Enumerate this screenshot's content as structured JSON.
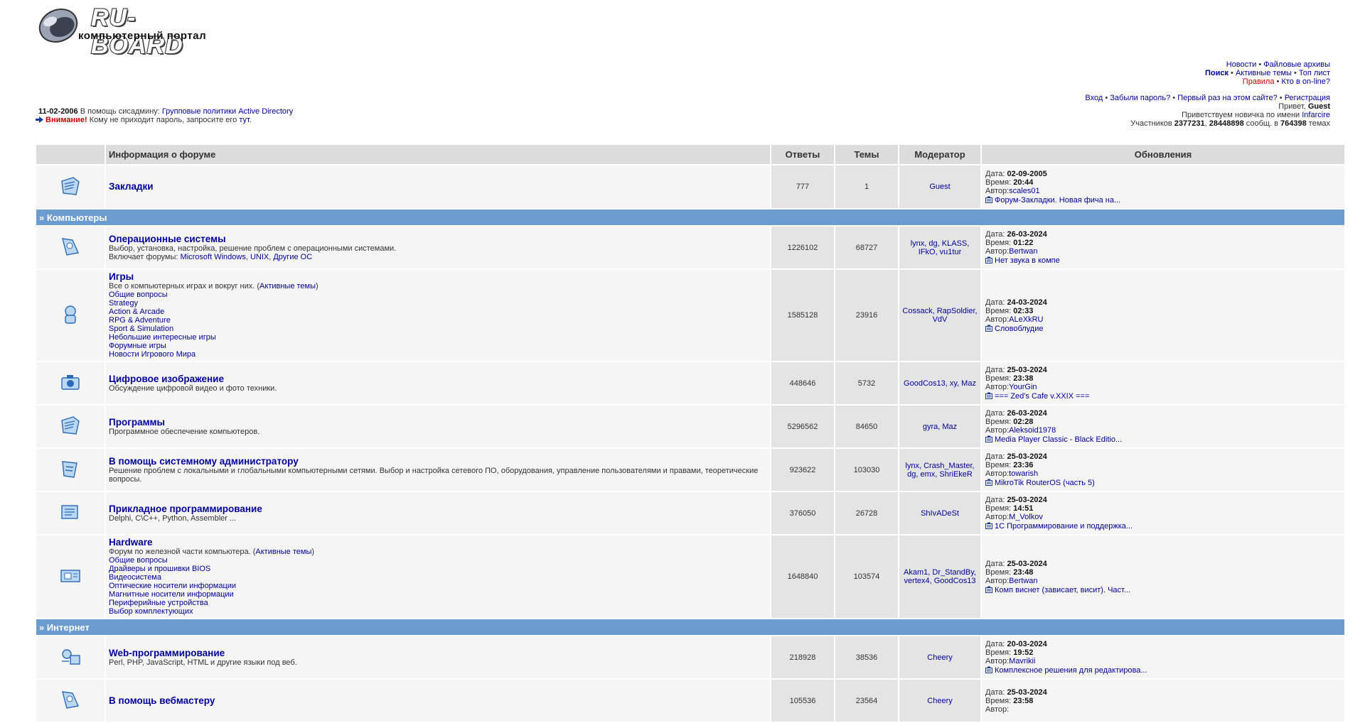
{
  "logo": {
    "title": "RU-BOARD",
    "subtitle": "компьютерный портал"
  },
  "topnav": {
    "line1": [
      "Новости",
      "Файловые архивы"
    ],
    "line2": [
      "Поиск",
      "Активные темы",
      "Топ лист"
    ],
    "line3": [
      "Правила",
      "Кто в on-line?"
    ]
  },
  "userbox": {
    "links": [
      "Вход",
      "Забыли пароль?",
      "Первый раз на этом сайте?",
      "Регистрация"
    ],
    "greeting_prefix": "Привет,",
    "greeting_user": "Guest",
    "newbie_prefix": "Приветствуем новичка по имени",
    "newbie_name": "Infarcire",
    "stats_prefix": "Участников",
    "members": "2377231",
    "posts": "28448898",
    "posts_word": "сообщ. в",
    "topics": "764398",
    "topics_word": "темах"
  },
  "news": {
    "date": "11-02-2006",
    "section": "В помощь сисадмину:",
    "link": "Групповые политики Active Directory",
    "warn": "Внимание!",
    "warn_text": "Кому не приходит пароль, запросите его",
    "warn_link": "тут"
  },
  "table_headers": {
    "info": "Информация о форуме",
    "replies": "Ответы",
    "topics": "Темы",
    "moderator": "Модератор",
    "updates": "Обновления"
  },
  "labels": {
    "date": "Дата:",
    "time": "Время:",
    "author": "Автор:"
  },
  "bookmarks": {
    "title": "Закладки",
    "replies": "777",
    "topics": "1",
    "moderator": "Guest",
    "date": "02-09-2005",
    "time": "20:44",
    "author": "scales01",
    "last": "Форум-Закладки. Новая фича на..."
  },
  "categories": [
    {
      "name": "» Компьютеры",
      "forums": [
        {
          "title": "Операционные системы",
          "desc": "Выбор, установка, настройка, решение проблем с операционными системами.",
          "includes_prefix": "Включает форумы:",
          "includes": [
            "Microsoft Windows",
            "UNIX",
            "Другие ОС"
          ],
          "replies": "1226102",
          "topics": "68727",
          "moderators": "lynx, dg, KLASS, IFkO, vu1tur",
          "date": "26-03-2024",
          "time": "01:22",
          "author": "Bertwan",
          "last": "Нет звука в компе"
        },
        {
          "title": "Игры",
          "desc": "Все о компьютерных играх и вокруг них. (",
          "desc_link": "Активные темы",
          "desc_end": ")",
          "subforums": [
            "Общие вопросы",
            "Strategy",
            "Action & Arcade",
            "RPG & Adventure",
            "Sport & Simulation",
            "Небольшие интересные игры",
            "Форумные игры",
            "Новости Игрового Мира"
          ],
          "replies": "1585128",
          "topics": "23916",
          "moderators": "Cossack, RapSoldier, VdV",
          "date": "24-03-2024",
          "time": "02:33",
          "author": "ALeXkRU",
          "last": "Словоблудие"
        },
        {
          "title": "Цифровое изображение",
          "desc": "Обсуждение цифровой видео и фото техники.",
          "replies": "448646",
          "topics": "5732",
          "moderators": "GoodCos13, xy, Maz",
          "date": "25-03-2024",
          "time": "23:38",
          "author": "YourGin",
          "last": "=== Zed's Cafe v.XXIX ==="
        },
        {
          "title": "Программы",
          "desc": "Программное обеспечение компьютеров.",
          "replies": "5296562",
          "topics": "84650",
          "moderators": "gyra, Maz",
          "date": "26-03-2024",
          "time": "02:28",
          "author": "Aleksoid1978",
          "last": "Media Player Classic - Black Editio..."
        },
        {
          "title": "В помощь системному администратору",
          "desc": "Решение проблем с локальными и глобальными компьютерными сетями. Выбор и настройка сетевого ПО, оборудования, управление пользователями и правами, теоретические вопросы.",
          "replies": "923622",
          "topics": "103030",
          "moderators": "lynx, Crash_Master, dg, emx, ShriEkeR",
          "date": "25-03-2024",
          "time": "23:36",
          "author": "towarish",
          "last": "MikroTik RouterOS (часть 5)"
        },
        {
          "title": "Прикладное программирование",
          "desc": "Delphi, C\\C++, Python, Assembler ...",
          "replies": "376050",
          "topics": "26728",
          "moderators": "ShIvADeSt",
          "date": "25-03-2024",
          "time": "14:51",
          "author": "M_Volkov",
          "last": "1С Программирование и поддержка..."
        },
        {
          "title": "Hardware",
          "desc": "Форум по железной части компьютера. (",
          "desc_link": "Активные темы",
          "desc_end": ")",
          "subforums": [
            "Общие вопросы",
            "Драйверы и прошивки BIOS",
            "Видеосистема",
            "Оптические носители информации",
            "Магнитные носители информации",
            "Периферийные устройства",
            "Выбор комплектующих"
          ],
          "replies": "1648840",
          "topics": "103574",
          "moderators": "Akam1, Dr_StandBy, vertex4, GoodCos13",
          "date": "25-03-2024",
          "time": "23:48",
          "author": "Bertwan",
          "last": "Комп виснет (зависает, висит). Част..."
        }
      ]
    },
    {
      "name": "» Интернет",
      "forums": [
        {
          "title": "Web-программирование",
          "desc": "Perl, PHP, JavaScript, HTML и другие языки под веб.",
          "replies": "218928",
          "topics": "38536",
          "moderators": "Cheery",
          "date": "20-03-2024",
          "time": "19:52",
          "author": "Mavrikii",
          "last": "Комплексное решения для редактирова..."
        },
        {
          "title": "В помощь вебмастеру",
          "desc": "",
          "replies": "105536",
          "topics": "23564",
          "moderators": "Cheery",
          "date": "25-03-2024",
          "time": "23:58",
          "author": "",
          "last": ""
        }
      ]
    }
  ],
  "colors": {
    "link": "#000099",
    "category_bar": "#6c9bcf",
    "header_bg": "#dcdcdc",
    "warning": "#cc0000"
  },
  "icons": [
    "mouse-logo-icon",
    "forum-folder-icon",
    "arrow-right-icon",
    "post-icon"
  ]
}
